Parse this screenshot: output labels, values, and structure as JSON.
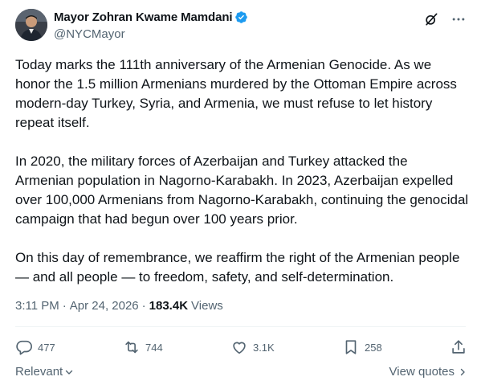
{
  "author": {
    "display_name": "Mayor Zohran Kwame Mamdani",
    "handle": "@NYCMayor",
    "verified": true,
    "verified_color": "#1d9bf0"
  },
  "header_icons": [
    "grok-icon",
    "more-icon"
  ],
  "tweet": {
    "paragraphs": [
      "Today marks the 111th anniversary of the Armenian Genocide. As we honor the 1.5 million Armenians murdered by the Ottoman Empire across modern-day Turkey, Syria, and Armenia, we must refuse to let history repeat itself.",
      "In 2020, the military forces of Azerbaijan and Turkey attacked the Armenian population in Nagorno-Karabakh. In 2023, Azerbaijan expelled over 100,000 Armenians from Nagorno-Karabakh, continuing the genocidal campaign that had begun over 100 years prior.",
      "On this day of remembrance, we reaffirm the right of the Armenian people — and all people — to freedom, safety, and self-determination."
    ]
  },
  "meta": {
    "time": "3:11 PM",
    "separator": "·",
    "date": "Apr 24, 2026",
    "views_count": "183.4K",
    "views_label": "Views"
  },
  "actions": {
    "replies": "477",
    "reposts": "744",
    "likes": "3.1K",
    "bookmarks": "258"
  },
  "footer": {
    "sort_label": "Relevant",
    "view_quotes_label": "View quotes"
  },
  "colors": {
    "text": "#0f1419",
    "secondary": "#536471",
    "divider": "#eff3f4"
  }
}
